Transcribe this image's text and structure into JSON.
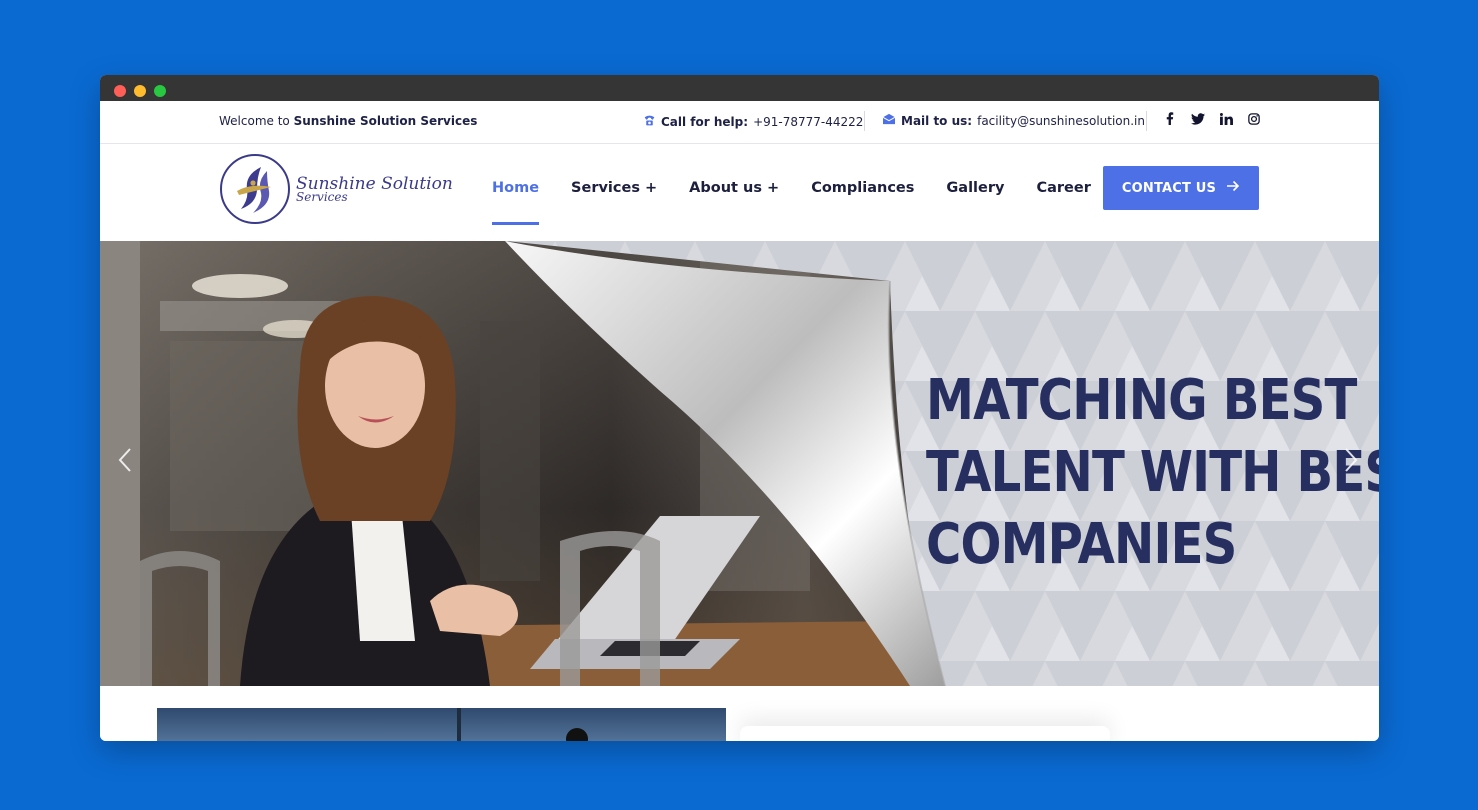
{
  "topbar": {
    "welcome_prefix": "Welcome to",
    "welcome_brand": "Sunshine Solution Services",
    "help_label": "Call for help:",
    "help_phone": "+91-78777-44222",
    "mail_label": "Mail to us:",
    "mail_email": "facility@sunshinesolution.in",
    "socials": [
      "facebook",
      "twitter",
      "linkedin",
      "instagram"
    ]
  },
  "logo": {
    "line1": "Sunshine Solution",
    "line2": "Services"
  },
  "nav": {
    "items": [
      {
        "label": "Home",
        "active": true
      },
      {
        "label": "Services +"
      },
      {
        "label": "About us +"
      },
      {
        "label": "Compliances"
      },
      {
        "label": "Gallery"
      },
      {
        "label": "Career"
      }
    ],
    "cta_label": "CONTACT US"
  },
  "hero": {
    "line1": "MATCHING BEST",
    "line2": "TALENT WITH BEST",
    "line3": "COMPANIES"
  },
  "colors": {
    "page_bg": "#0a6ad2",
    "accent": "#4e70e6",
    "heading": "#262f60",
    "chrome": "#353535"
  }
}
